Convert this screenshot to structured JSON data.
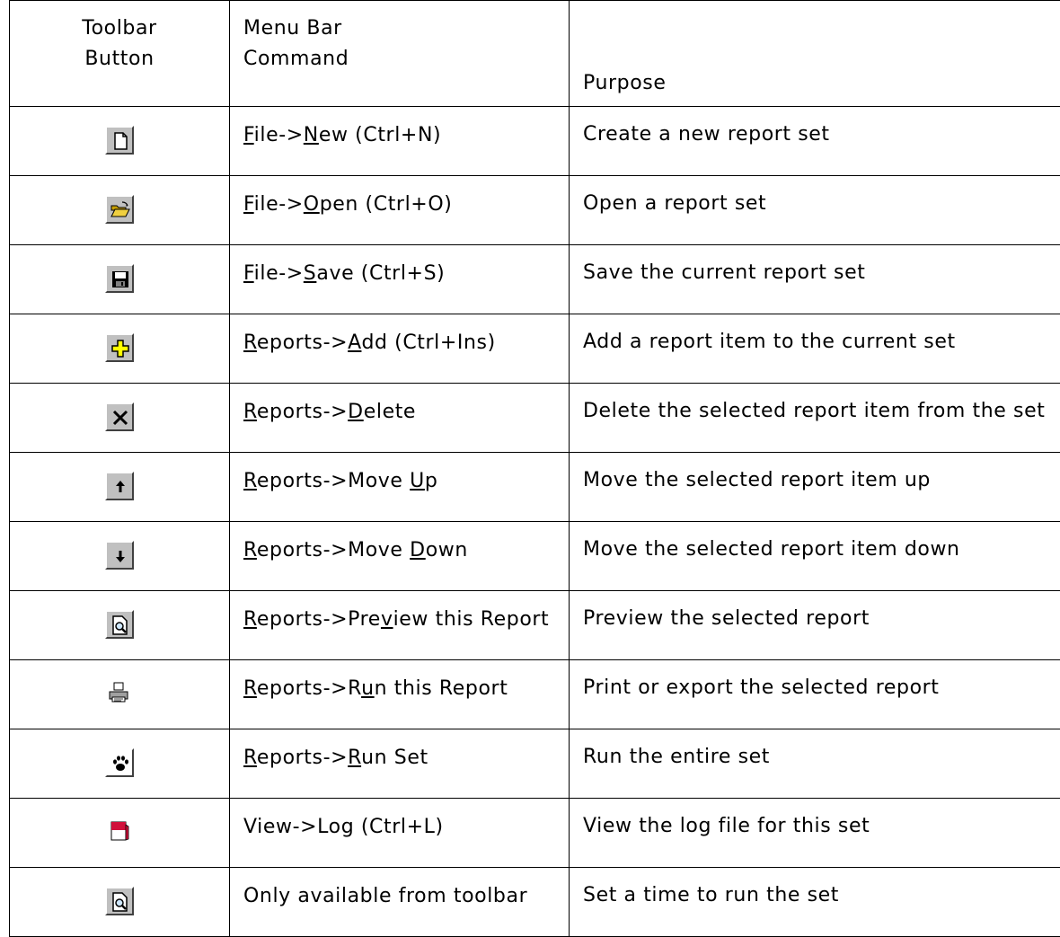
{
  "header": {
    "col1_line1": "Toolbar",
    "col1_line2": "Button",
    "col2_line1": "Menu Bar",
    "col2_line2": "Command",
    "col3": "Purpose"
  },
  "rows": [
    {
      "icon": "new-document-icon",
      "cmd": [
        [
          "F",
          "u"
        ],
        [
          "ile->",
          ""
        ],
        [
          "N",
          "u"
        ],
        [
          "ew (Ctrl+N)",
          ""
        ]
      ],
      "purpose": "Create a new report set"
    },
    {
      "icon": "open-folder-icon",
      "cmd": [
        [
          "F",
          "u"
        ],
        [
          "ile->",
          ""
        ],
        [
          "O",
          "u"
        ],
        [
          "pen (Ctrl+O)",
          ""
        ]
      ],
      "purpose": "Open a report set"
    },
    {
      "icon": "save-disk-icon",
      "cmd": [
        [
          "F",
          "u"
        ],
        [
          "ile->",
          ""
        ],
        [
          "S",
          "u"
        ],
        [
          "ave (Ctrl+S)",
          ""
        ]
      ],
      "purpose": "Save the current report set"
    },
    {
      "icon": "add-plus-icon",
      "cmd": [
        [
          "R",
          "u"
        ],
        [
          "eports->",
          ""
        ],
        [
          "A",
          "u"
        ],
        [
          "dd (Ctrl+Ins)",
          ""
        ]
      ],
      "purpose": "Add a report item to the current set"
    },
    {
      "icon": "delete-x-icon",
      "cmd": [
        [
          "R",
          "u"
        ],
        [
          "eports->",
          ""
        ],
        [
          "D",
          "u"
        ],
        [
          "elete",
          ""
        ]
      ],
      "purpose": "Delete the selected report item from the set"
    },
    {
      "icon": "arrow-up-icon",
      "cmd": [
        [
          "R",
          "u"
        ],
        [
          "eports->Move ",
          ""
        ],
        [
          "U",
          "u"
        ],
        [
          "p",
          ""
        ]
      ],
      "purpose": "Move the selected report item up"
    },
    {
      "icon": "arrow-down-icon",
      "cmd": [
        [
          "R",
          "u"
        ],
        [
          "eports->Move ",
          ""
        ],
        [
          "D",
          "u"
        ],
        [
          "own",
          ""
        ]
      ],
      "purpose": "Move the selected report item down"
    },
    {
      "icon": "preview-magnifier-icon",
      "cmd": [
        [
          "R",
          "u"
        ],
        [
          "eports->Pre",
          ""
        ],
        [
          "v",
          "u"
        ],
        [
          "iew this Report",
          ""
        ]
      ],
      "purpose": "Preview the selected report"
    },
    {
      "icon": "printer-icon",
      "cmd": [
        [
          "R",
          "u"
        ],
        [
          "eports->R",
          ""
        ],
        [
          "u",
          "u"
        ],
        [
          "n this Report",
          ""
        ]
      ],
      "purpose": "Print or export the selected report"
    },
    {
      "icon": "paw-print-icon",
      "cmd": [
        [
          "R",
          "u"
        ],
        [
          "eports->",
          ""
        ],
        [
          "R",
          "u"
        ],
        [
          "un Set",
          ""
        ]
      ],
      "purpose": "Run the entire set"
    },
    {
      "icon": "log-book-icon",
      "cmd": [
        [
          "View->Log (Ctrl+L)",
          ""
        ]
      ],
      "purpose": "View the log file for this set"
    },
    {
      "icon": "schedule-preview-icon",
      "cmd": [
        [
          "Only available from toolbar",
          ""
        ]
      ],
      "purpose": "Set a time to run the set"
    }
  ]
}
